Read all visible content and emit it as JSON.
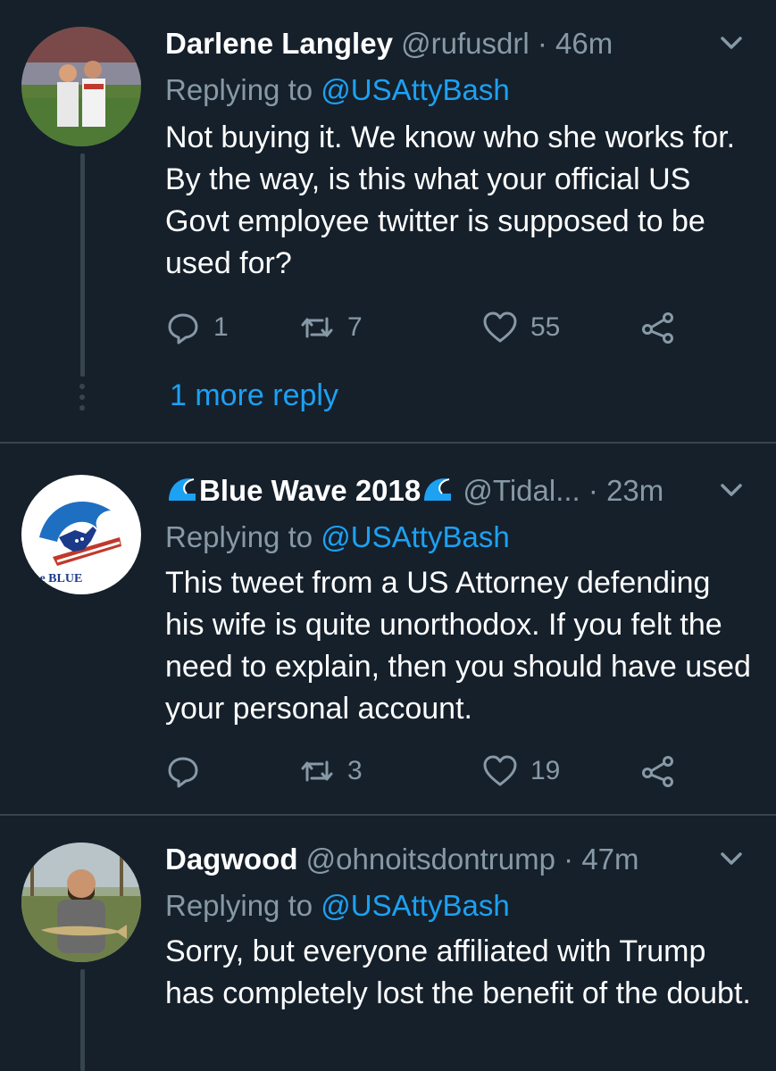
{
  "tweets": [
    {
      "name": "Darlene Langley",
      "handle": "@rufusdrl",
      "time": "· 46m",
      "replying_prefix": "Replying to ",
      "replying_to": "@USAttyBash",
      "text": "Not buying it. We know who she works for. By the way, is this what your official US Govt employee twitter is supposed to be used for?",
      "reply_count": "1",
      "retweet_count": "7",
      "like_count": "55",
      "more_replies": "1 more reply"
    },
    {
      "name": "Blue Wave 2018",
      "handle": "@Tidal...",
      "time": "· 23m",
      "replying_prefix": "Replying to ",
      "replying_to": "@USAttyBash",
      "text": "This tweet from a US Attorney defending his wife is quite unorthodox. If you felt the need to explain, then you should have used your personal account.",
      "reply_count": "",
      "retweet_count": "3",
      "like_count": "19",
      "avatar_text": "the BLUE"
    },
    {
      "name": "Dagwood",
      "handle": "@ohnoitsdontrump",
      "time": "· 47m",
      "replying_prefix": "Replying to ",
      "replying_to": "@USAttyBash",
      "text": "Sorry, but everyone affiliated with Trump has completely lost the benefit of the doubt."
    }
  ],
  "colors": {
    "background": "#15202b",
    "separator": "#38444d",
    "secondary_text": "#8899a6",
    "accent": "#1da1f2"
  },
  "icons": [
    "chevron-down-icon",
    "reply-icon",
    "retweet-icon",
    "like-icon",
    "share-icon",
    "wave-emoji-icon"
  ]
}
